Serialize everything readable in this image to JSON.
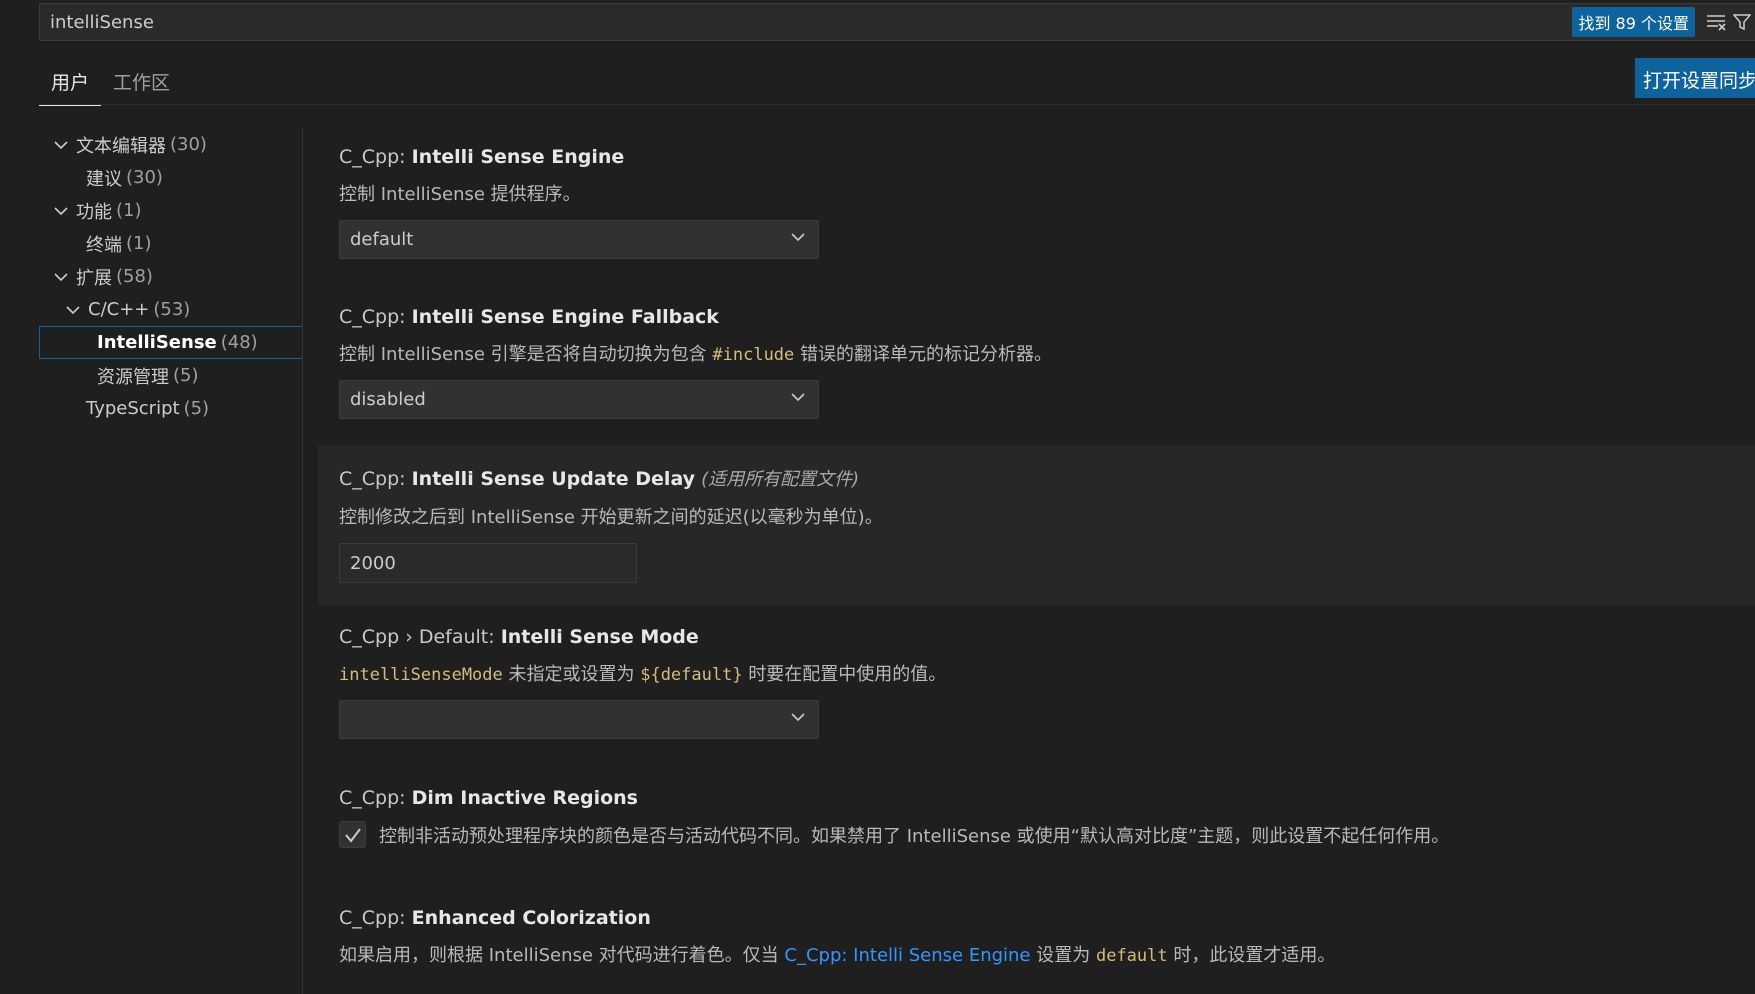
{
  "search": {
    "value": "intelliSense",
    "result_badge": "找到 89 个设置"
  },
  "tabs": [
    {
      "label": "用户",
      "active": true
    },
    {
      "label": "工作区",
      "active": false
    }
  ],
  "sync_button": "打开设置同步",
  "tree": [
    {
      "label": "文本编辑器",
      "count": "(30)",
      "level": 0,
      "expanded": true
    },
    {
      "label": "建议",
      "count": "(30)",
      "level": 1
    },
    {
      "label": "功能",
      "count": "(1)",
      "level": 0,
      "expanded": true
    },
    {
      "label": "终端",
      "count": "(1)",
      "level": 1
    },
    {
      "label": "扩展",
      "count": "(58)",
      "level": 0,
      "expanded": true
    },
    {
      "label": "C/C++",
      "count": "(53)",
      "level": 1,
      "expanded": true
    },
    {
      "label": "IntelliSense",
      "count": "(48)",
      "level": 2,
      "selected": true
    },
    {
      "label": "资源管理",
      "count": "(5)",
      "level": 2
    },
    {
      "label": "TypeScript",
      "count": "(5)",
      "level": 1
    }
  ],
  "settings": {
    "engine": {
      "category": "C_Cpp: ",
      "key": "Intelli Sense Engine",
      "desc": "控制 IntelliSense 提供程序。",
      "value": "default"
    },
    "fallback": {
      "category": "C_Cpp: ",
      "key": "Intelli Sense Engine Fallback",
      "desc_pre": "控制 IntelliSense 引擎是否将自动切换为包含 ",
      "desc_code": "#include",
      "desc_post": " 错误的翻译单元的标记分析器。",
      "value": "disabled"
    },
    "delay": {
      "category": "C_Cpp: ",
      "key": "Intelli Sense Update Delay",
      "scope": "(适用所有配置文件)",
      "desc": "控制修改之后到 IntelliSense 开始更新之间的延迟(以毫秒为单位)。",
      "value": "2000"
    },
    "mode": {
      "category": "C_Cpp › Default: ",
      "key": "Intelli Sense Mode",
      "desc_code1": "intelliSenseMode",
      "desc_mid": " 未指定或设置为 ",
      "desc_code2": "${default}",
      "desc_post": " 时要在配置中使用的值。",
      "value": ""
    },
    "dim": {
      "category": "C_Cpp: ",
      "key": "Dim Inactive Regions",
      "desc": "控制非活动预处理程序块的颜色是否与活动代码不同。如果禁用了 IntelliSense 或使用“默认高对比度”主题，则此设置不起任何作用。",
      "checked": true
    },
    "color": {
      "category": "C_Cpp: ",
      "key": "Enhanced Colorization",
      "desc_pre": "如果启用，则根据 IntelliSense 对代码进行着色。仅当 ",
      "desc_link": "C_Cpp: Intelli Sense Engine",
      "desc_mid": " 设置为 ",
      "desc_code": "default",
      "desc_post": " 时，此设置才适用。"
    }
  },
  "colors": {
    "background": "#1f1f1f",
    "accent": "#0e639c",
    "code": "#d7ba7d",
    "link": "#3794ff"
  }
}
